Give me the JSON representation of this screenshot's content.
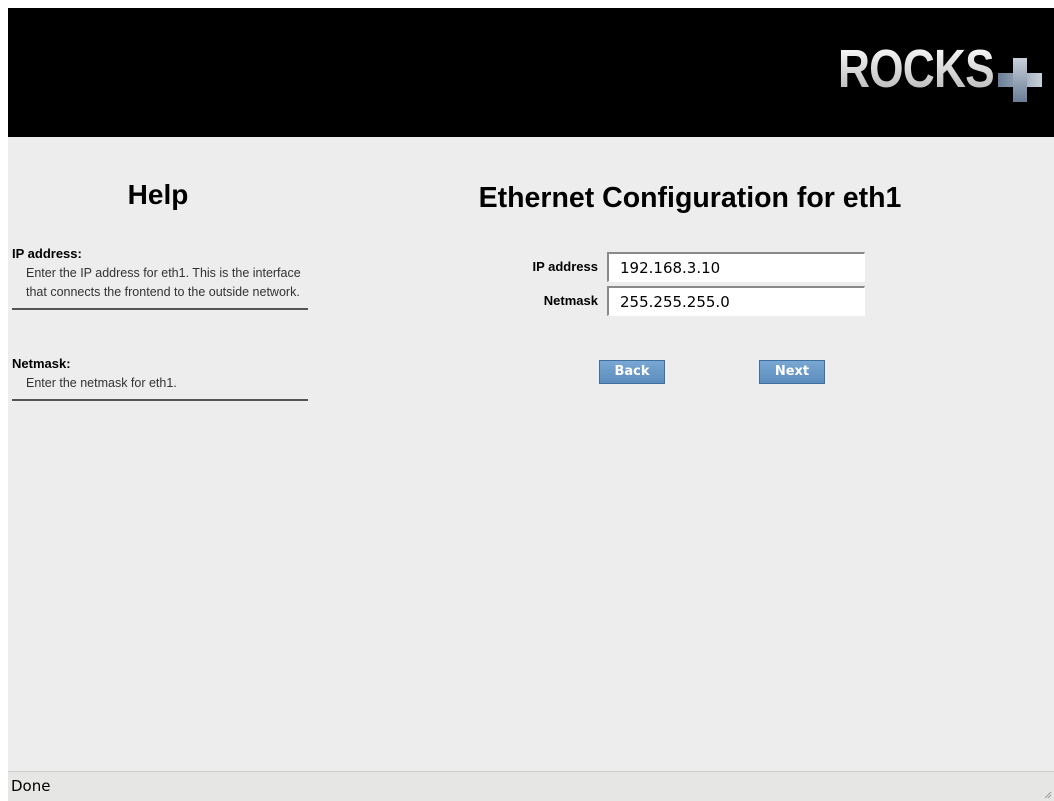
{
  "banner": {
    "logo_text": "ROCKS",
    "logo_icon": "plus-icon"
  },
  "help": {
    "title": "Help",
    "items": [
      {
        "term": "IP address:",
        "description": "Enter the IP address for eth1. This is the interface that connects the frontend to the outside network."
      },
      {
        "term": "Netmask:",
        "description": "Enter the netmask for eth1."
      }
    ]
  },
  "main": {
    "title": "Ethernet Configuration for eth1",
    "fields": [
      {
        "label": "IP address",
        "value": "192.168.3.10"
      },
      {
        "label": "Netmask",
        "value": "255.255.255.0"
      }
    ],
    "buttons": {
      "back": "Back",
      "next": "Next"
    }
  },
  "statusbar": {
    "text": "Done"
  },
  "colors": {
    "banner_bg": "#000000",
    "page_bg": "#ededed",
    "button_bg": "#6b9aca",
    "button_text": "#ffffff"
  }
}
